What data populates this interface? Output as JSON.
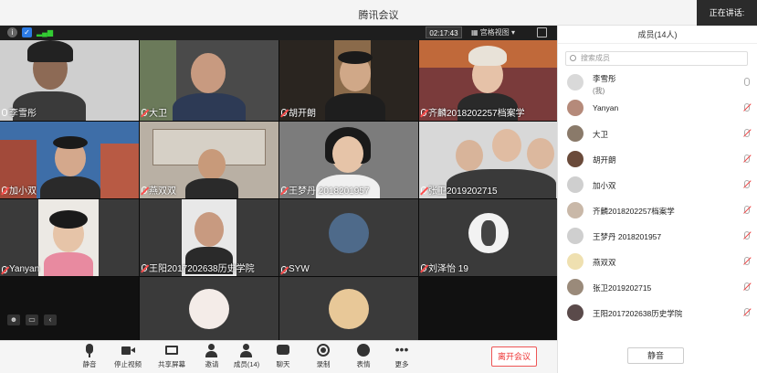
{
  "window": {
    "title": "腾讯会议",
    "speaking_label": "正在讲话:"
  },
  "infobar": {
    "timer": "02:17:43",
    "view_mode": "宫格视图 ▾"
  },
  "tiles": [
    {
      "name": "李雪彤",
      "muted": false,
      "bg": "#cfcfcf"
    },
    {
      "name": "大卫",
      "muted": true,
      "bg": "#4a4a4a"
    },
    {
      "name": "胡开朗",
      "muted": true,
      "bg": "#6b5a4a"
    },
    {
      "name": "齐麟2018202257档案学",
      "muted": true,
      "bg": "#7a3b3b"
    },
    {
      "name": "加小双",
      "muted": true,
      "bg": "#3e6ea8"
    },
    {
      "name": "燕双双",
      "muted": true,
      "bg": "#b9b0a4"
    },
    {
      "name": "王梦丹 2018201957",
      "muted": true,
      "bg": "#7c7c7c"
    },
    {
      "name": "张卫2019202715",
      "muted": true,
      "bg": "#d8d8d8"
    },
    {
      "name": "Yanyan",
      "muted": true,
      "bg": "#ece9e4"
    },
    {
      "name": "王阳2017202638历史学院",
      "muted": true,
      "bg": "#e8e8e8"
    },
    {
      "name": "SYW",
      "muted": true,
      "bg": "#3a3a3a"
    },
    {
      "name": "刘泽怡 19",
      "muted": true,
      "bg": "#3a3a3a"
    },
    {
      "name": "",
      "muted": false,
      "bg": "#111111"
    },
    {
      "name": "",
      "muted": false,
      "bg": "#3a3a3a"
    },
    {
      "name": "",
      "muted": false,
      "bg": "#3a3a3a"
    },
    {
      "name": "",
      "muted": false,
      "bg": "#111111"
    }
  ],
  "toolbar": {
    "mute": "静音",
    "stop_video": "停止视频",
    "share": "共享屏幕",
    "invite": "邀请",
    "members": "成员(14)",
    "chat": "聊天",
    "record": "录制",
    "emoji": "表情",
    "more": "更多",
    "leave": "离开会议"
  },
  "panel": {
    "title": "成员(14人)",
    "search_placeholder": "搜索成员",
    "mute_all": "静音",
    "members": [
      {
        "name": "李雪彤",
        "sub": "(我)",
        "mic": "on",
        "color": "#d9d9d9"
      },
      {
        "name": "Yanyan",
        "mic": "off",
        "color": "#b58a7a"
      },
      {
        "name": "大卫",
        "mic": "off",
        "color": "#8a7a6a"
      },
      {
        "name": "胡开朗",
        "mic": "off",
        "color": "#6a4a3a"
      },
      {
        "name": "加小双",
        "mic": "off",
        "color": "#cfcfcf"
      },
      {
        "name": "齐麟2018202257档案学",
        "mic": "off",
        "color": "#c9b8a8"
      },
      {
        "name": "王梦丹 2018201957",
        "mic": "off",
        "color": "#cfcfcf"
      },
      {
        "name": "燕双双",
        "mic": "off",
        "color": "#efe0b0"
      },
      {
        "name": "张卫2019202715",
        "mic": "off",
        "color": "#9a8a7a"
      },
      {
        "name": "王阳2017202638历史学院",
        "mic": "off",
        "color": "#5a4a4a"
      }
    ]
  },
  "colors": {
    "leave": "#e33333",
    "muted": "#ff4d4d",
    "accent": "#2c7be5"
  }
}
